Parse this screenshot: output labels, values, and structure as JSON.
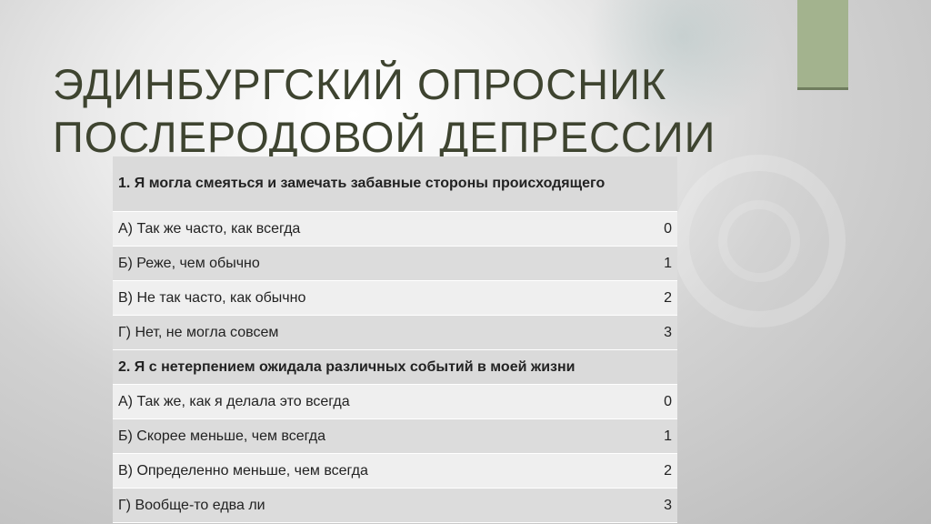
{
  "title": {
    "line1": "ЭДИНБУРГСКИЙ ОПРОСНИК",
    "line2": "ПОСЛЕРОДОВОЙ ДЕПРЕССИИ"
  },
  "colors": {
    "title": "#3e4430",
    "accent": "#a3b38e"
  },
  "questions": [
    {
      "text": "1. Я могла смеяться и замечать забавные стороны происходящего",
      "answers": [
        {
          "label": "А) Так же часто, как всегда",
          "score": "0"
        },
        {
          "label": "Б) Реже, чем обычно",
          "score": "1"
        },
        {
          "label": "В) Не так часто, как обычно",
          "score": "2"
        },
        {
          "label": "Г) Нет, не могла совсем",
          "score": "3"
        }
      ]
    },
    {
      "text": "2. Я с нетерпением ожидала различных событий в моей жизни",
      "answers": [
        {
          "label": "А) Так же, как я делала это всегда",
          "score": "0"
        },
        {
          "label": "Б) Скорее меньше, чем всегда",
          "score": "1"
        },
        {
          "label": "В) Определенно меньше, чем всегда",
          "score": "2"
        },
        {
          "label": "Г) Вообще-то едва ли",
          "score": "3"
        }
      ]
    }
  ]
}
